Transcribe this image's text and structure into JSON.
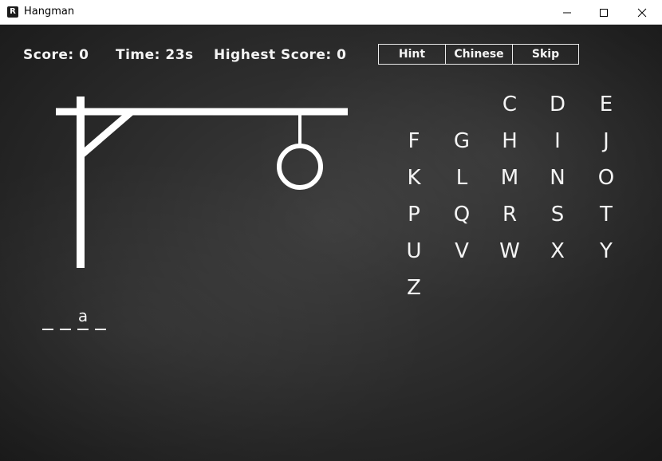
{
  "window": {
    "title": "Hangman",
    "icon": "hangman-app-icon"
  },
  "stats": {
    "score_label": "Score: 0",
    "time_label": "Time: 23s",
    "highest_label": "Highest Score: 0"
  },
  "toolbar": {
    "hint": "Hint",
    "chinese": "Chinese",
    "skip": "Skip"
  },
  "letters": [
    "C",
    "D",
    "E",
    "F",
    "G",
    "H",
    "I",
    "J",
    "K",
    "L",
    "M",
    "N",
    "O",
    "P",
    "Q",
    "R",
    "S",
    "T",
    "U",
    "V",
    "W",
    "X",
    "Y",
    "Z"
  ],
  "word": {
    "slots": [
      "",
      "",
      "a",
      ""
    ]
  },
  "colors": {
    "chalk": "#f4f4f4",
    "board": "#262626",
    "titlebar": "#ffffff"
  }
}
